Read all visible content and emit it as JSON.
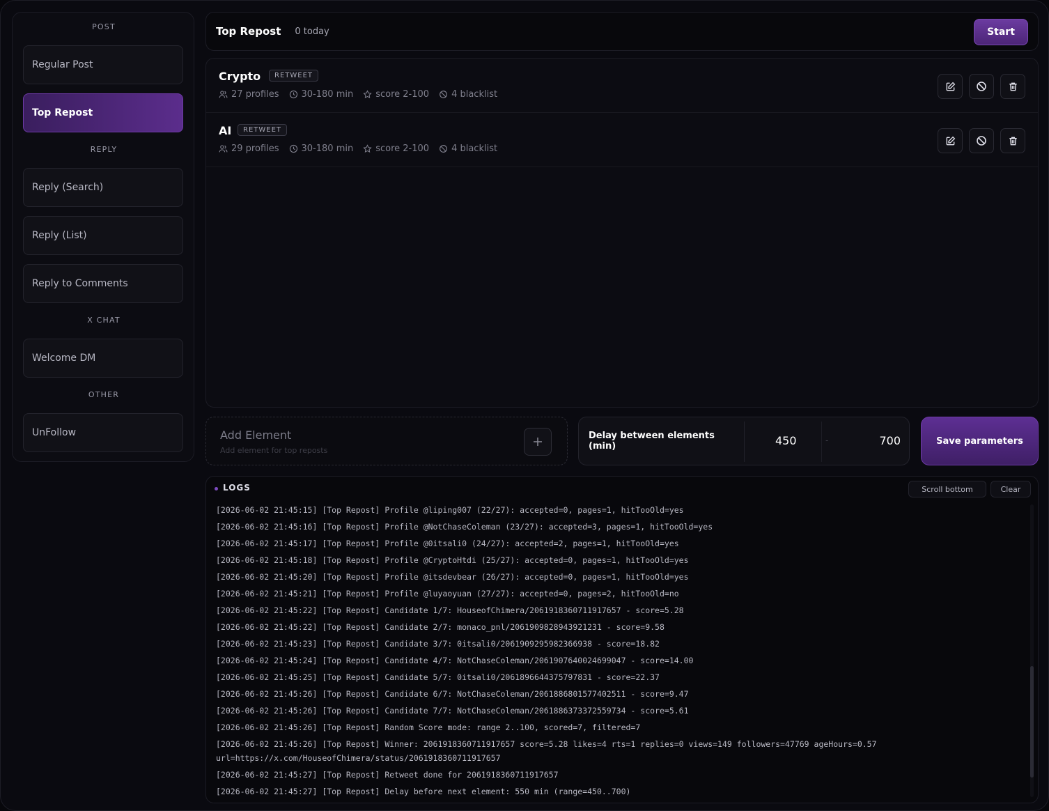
{
  "sidebar": {
    "sections": [
      {
        "label": "POST"
      },
      {
        "label": "REPLY"
      },
      {
        "label": "X CHAT"
      },
      {
        "label": "OTHER"
      }
    ],
    "items": [
      {
        "label": "Regular Post"
      },
      {
        "label": "Top Repost"
      },
      {
        "label": "Reply (Search)"
      },
      {
        "label": "Reply (List)"
      },
      {
        "label": "Reply to Comments"
      },
      {
        "label": "Welcome DM"
      },
      {
        "label": "UnFollow"
      }
    ]
  },
  "header": {
    "title": "Top Repost",
    "count": "0 today",
    "start_label": "Start"
  },
  "elements": [
    {
      "name": "Crypto",
      "badge": "RETWEET",
      "profiles": "27 profiles",
      "interval": "30-180 min",
      "score": "score 2-100",
      "blacklist": "4 blacklist"
    },
    {
      "name": "AI",
      "badge": "RETWEET",
      "profiles": "29 profiles",
      "interval": "30-180 min",
      "score": "score 2-100",
      "blacklist": "4 blacklist"
    }
  ],
  "add_element": {
    "title": "Add Element",
    "subtitle": "Add element for top reposts"
  },
  "delay": {
    "label": "Delay between elements (min)",
    "min": "450",
    "separator": "-",
    "max": "700"
  },
  "save_label": "Save parameters",
  "logs": {
    "title": "LOGS",
    "scroll_bottom_label": "Scroll bottom",
    "clear_label": "Clear",
    "lines": [
      "[2026-06-02 21:45:15] [Top Repost] Profile @liping007 (22/27): accepted=0, pages=1, hitTooOld=yes",
      "[2026-06-02 21:45:16] [Top Repost] Profile @NotChaseColeman (23/27): accepted=3, pages=1, hitTooOld=yes",
      "[2026-06-02 21:45:17] [Top Repost] Profile @0itsali0 (24/27): accepted=2, pages=1, hitTooOld=yes",
      "[2026-06-02 21:45:18] [Top Repost] Profile @CryptoHtdi (25/27): accepted=0, pages=1, hitTooOld=yes",
      "[2026-06-02 21:45:20] [Top Repost] Profile @itsdevbear (26/27): accepted=0, pages=1, hitTooOld=yes",
      "[2026-06-02 21:45:21] [Top Repost] Profile @luyaoyuan (27/27): accepted=0, pages=2, hitTooOld=no",
      "[2026-06-02 21:45:22] [Top Repost] Candidate 1/7: HouseofChimera/2061918360711917657 - score=5.28",
      "[2026-06-02 21:45:22] [Top Repost] Candidate 2/7: monaco_pnl/2061909828943921231 - score=9.58",
      "[2026-06-02 21:45:23] [Top Repost] Candidate 3/7: 0itsali0/2061909295982366938 - score=18.82",
      "[2026-06-02 21:45:24] [Top Repost] Candidate 4/7: NotChaseColeman/2061907640024699047 - score=14.00",
      "[2026-06-02 21:45:25] [Top Repost] Candidate 5/7: 0itsali0/2061896644375797831 - score=22.37",
      "[2026-06-02 21:45:26] [Top Repost] Candidate 6/7: NotChaseColeman/2061886801577402511 - score=9.47",
      "[2026-06-02 21:45:26] [Top Repost] Candidate 7/7: NotChaseColeman/2061886373372559734 - score=5.61",
      "[2026-06-02 21:45:26] [Top Repost] Random Score mode: range 2..100, scored=7, filtered=7",
      "[2026-06-02 21:45:26] [Top Repost] Winner: 2061918360711917657 score=5.28 likes=4 rts=1 replies=0 views=149 followers=47769 ageHours=0.57 url=https://x.com/HouseofChimera/status/2061918360711917657",
      "[2026-06-02 21:45:27] [Top Repost] Retweet done for 2061918360711917657",
      "[2026-06-02 21:45:27] [Top Repost] Delay before next element: 550 min (range=450..700)"
    ]
  },
  "colors": {
    "accent": "#5b2d8c",
    "background": "#0a0a10"
  }
}
